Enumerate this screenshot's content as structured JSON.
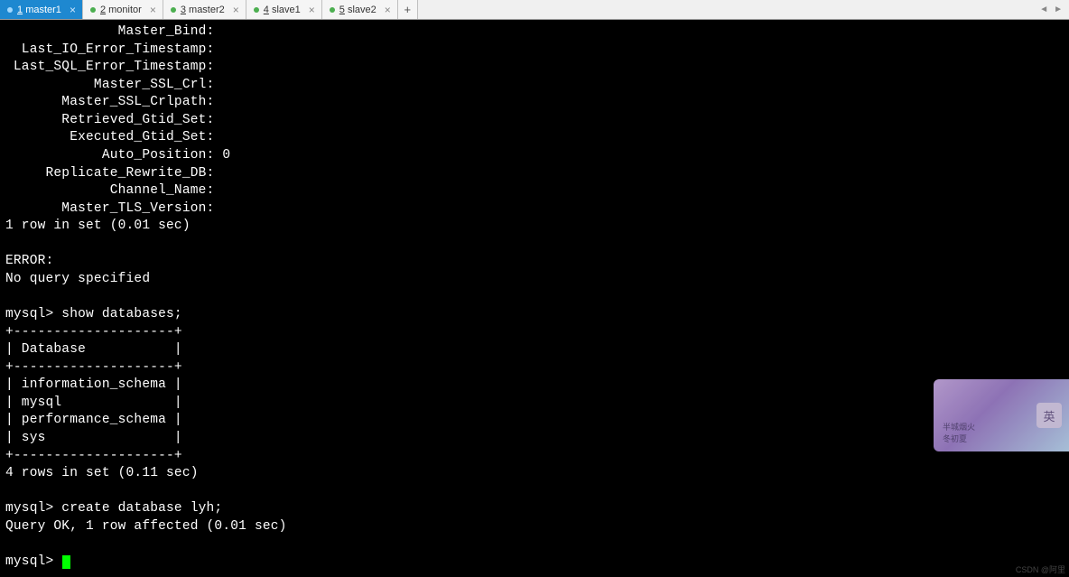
{
  "tabs": {
    "items": [
      {
        "num": "1",
        "name": "master1",
        "active": true
      },
      {
        "num": "2",
        "name": "monitor",
        "active": false
      },
      {
        "num": "3",
        "name": "master2",
        "active": false
      },
      {
        "num": "4",
        "name": "slave1",
        "active": false
      },
      {
        "num": "5",
        "name": "slave2",
        "active": false
      }
    ],
    "add": "+",
    "close": "×"
  },
  "terminal": {
    "status_block": "              Master_Bind: \n  Last_IO_Error_Timestamp: \n Last_SQL_Error_Timestamp: \n           Master_SSL_Crl: \n       Master_SSL_Crlpath: \n       Retrieved_Gtid_Set: \n        Executed_Gtid_Set: \n            Auto_Position: 0\n     Replicate_Rewrite_DB: \n             Channel_Name: \n       Master_TLS_Version: ",
    "set_result1": "1 row in set (0.01 sec)",
    "error_line1": "ERROR:",
    "error_line2": "No query specified",
    "prompt1": "mysql> show databases;",
    "table": "+--------------------+\n| Database           |\n+--------------------+\n| information_schema |\n| mysql              |\n| performance_schema |\n| sys                |\n+--------------------+",
    "set_result2": "4 rows in set (0.11 sec)",
    "prompt2": "mysql> create database lyh;",
    "query_ok": "Query OK, 1 row affected (0.01 sec)",
    "prompt3": "mysql> "
  },
  "badge": {
    "char": "英",
    "text1": "半城烟火",
    "text2": "冬初夏"
  },
  "watermark": "CSDN @阿里"
}
